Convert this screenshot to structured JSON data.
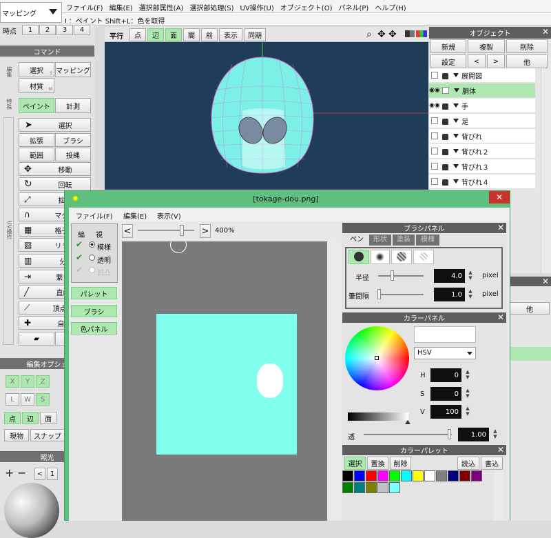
{
  "menubar": {
    "mode_select": "マッピング",
    "items": [
      "ファイル(F)",
      "編集(E)",
      "選択部属性(A)",
      "選択部処理(S)",
      "UV操作(U)",
      "オブジェクト(O)",
      "パネル(P)",
      "ヘルプ(H)"
    ],
    "hint": "L：ペイント  Shift+L：色を取得"
  },
  "left": {
    "tabs_label": "時点",
    "tabs": [
      "1",
      "2",
      "3",
      "4"
    ],
    "command_header": "コマンド",
    "cat_edit": "編集",
    "select": "選択",
    "select_sub": "S",
    "mapping": "マッピング",
    "material": "材質",
    "material_sub": "M",
    "cat_special": "特殊",
    "paint": "ペイント",
    "measure": "計測",
    "cat_uv": "UV操作",
    "tools": [
      "選択",
      "拡張",
      "ブラシ",
      "範囲",
      "投縄",
      "移動",
      "回転",
      "拡大",
      "マグネ",
      "格子変",
      "リラッ",
      "分離",
      "繋い合",
      "直線化",
      "頂点スラ",
      "自動展"
    ],
    "edit_options_header": "編集オプショ",
    "xyz": [
      "X",
      "Y",
      "Z"
    ],
    "lws": [
      "L",
      "W",
      "S"
    ],
    "pem": [
      "点",
      "辺",
      "面"
    ],
    "genbutsu": "現物",
    "snap": "スナップ",
    "lighting_header": "照光",
    "nav": [
      "+",
      "−",
      "<",
      "1"
    ]
  },
  "viewport": {
    "buttons": [
      "平行",
      "点",
      "辺",
      "面",
      "閣",
      "前",
      "表示",
      "同期"
    ]
  },
  "object_panel": {
    "title": "オブジェクト",
    "new": "新規",
    "duplicate": "複製",
    "delete": "削除",
    "settings": "設定",
    "prev": "<",
    "next": ">",
    "other": "他",
    "rows": [
      "展開図",
      "胴体",
      "手",
      "足",
      "背びれ",
      "背びれ２",
      "背びれ３",
      "背びれ４"
    ],
    "second_other": "他"
  },
  "texture_window": {
    "title": "[tokage-dou.png]",
    "menu": [
      "ファイル(F)",
      "編集(E)",
      "表示(V)"
    ],
    "zoom": "400%",
    "edit_label": "編",
    "view_label": "視",
    "pattern": "模様",
    "transparent": "透明",
    "bump": "凹凸",
    "palette_btn": "パレット",
    "brush_btn": "ブラシ",
    "color_btn": "色パネル"
  },
  "brush_panel": {
    "title": "ブラシパネル",
    "tabs": [
      "ペン",
      "形状",
      "塗装",
      "模様"
    ],
    "radius_label": "半径",
    "radius": "4.0",
    "interval_label": "筆間隔",
    "interval": "1.0",
    "unit": "pixel"
  },
  "color_panel": {
    "title": "カラーパネル",
    "mode": "HSV",
    "h": "0",
    "s": "0",
    "v": "100",
    "alpha_label": "透",
    "alpha": "1.00",
    "labels": {
      "h": "H",
      "s": "S",
      "v": "V"
    }
  },
  "palette_panel": {
    "title": "カラーパレット",
    "select": "選択",
    "replace": "置換",
    "delete": "削除",
    "load": "読込",
    "save": "書込",
    "colors": [
      "#000000",
      "#0000ff",
      "#ff0000",
      "#ff00ff",
      "#00ff00",
      "#00ffff",
      "#ffff00",
      "#ffffff",
      "#808080",
      "#000080",
      "#800000",
      "#800080",
      "#008000",
      "#008080",
      "#808000",
      "#c0c0c0",
      "#80ffff"
    ]
  },
  "colors": {
    "accent": "#aee8b0",
    "window_border": "#5fbf7f",
    "viewport_bg": "#1f3d58",
    "texture_fill": "#80ffee"
  }
}
